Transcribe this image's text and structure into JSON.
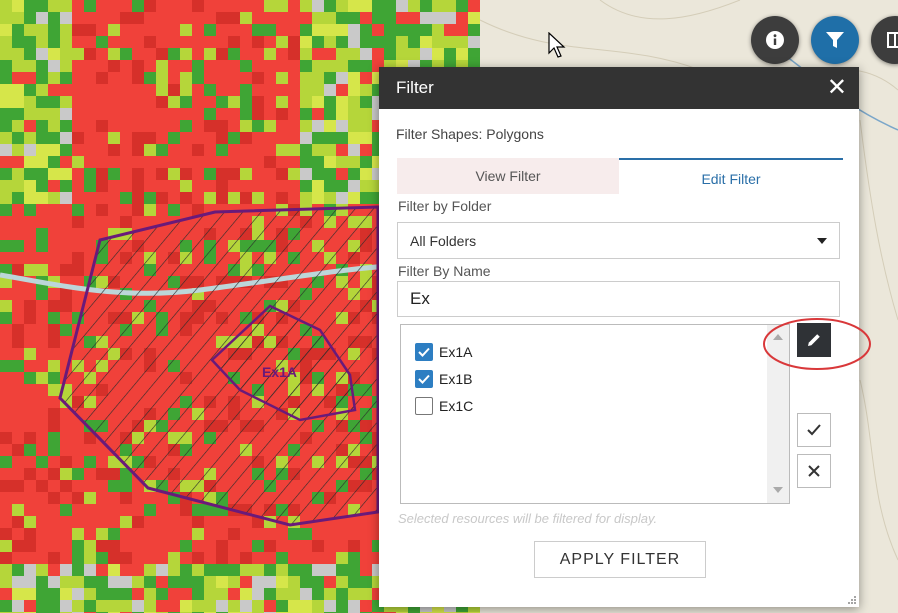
{
  "map": {
    "polygon_label": "Ex1A",
    "colors": {
      "red": "#f0413a",
      "dark_red": "#d6302a",
      "green": "#3fa535",
      "light_green": "#b5d63a",
      "yellow_green": "#d6e64a",
      "grey": "#c9c9c9",
      "polygon_outline": "#6a1a7a",
      "topo_bg": "#ebe7da"
    }
  },
  "toolbar": {
    "info_icon": "info-icon",
    "filter_icon": "filter-icon",
    "legend_icon": "layers-icon",
    "active_color": "#1f6fa8"
  },
  "dialog": {
    "title": "Filter",
    "subtitle": "Filter Shapes: Polygons",
    "tabs": [
      {
        "label": "View Filter",
        "active": false
      },
      {
        "label": "Edit Filter",
        "active": true
      }
    ],
    "folder": {
      "label": "Filter by Folder",
      "value": "All Folders"
    },
    "name_filter": {
      "label": "Filter By Name",
      "value": "Ex"
    },
    "items": [
      {
        "label": "Ex1A",
        "checked": true
      },
      {
        "label": "Ex1B",
        "checked": true
      },
      {
        "label": "Ex1C",
        "checked": false
      }
    ],
    "hint": "Selected resources will be filtered for display.",
    "apply_label": "APPLY FILTER"
  }
}
